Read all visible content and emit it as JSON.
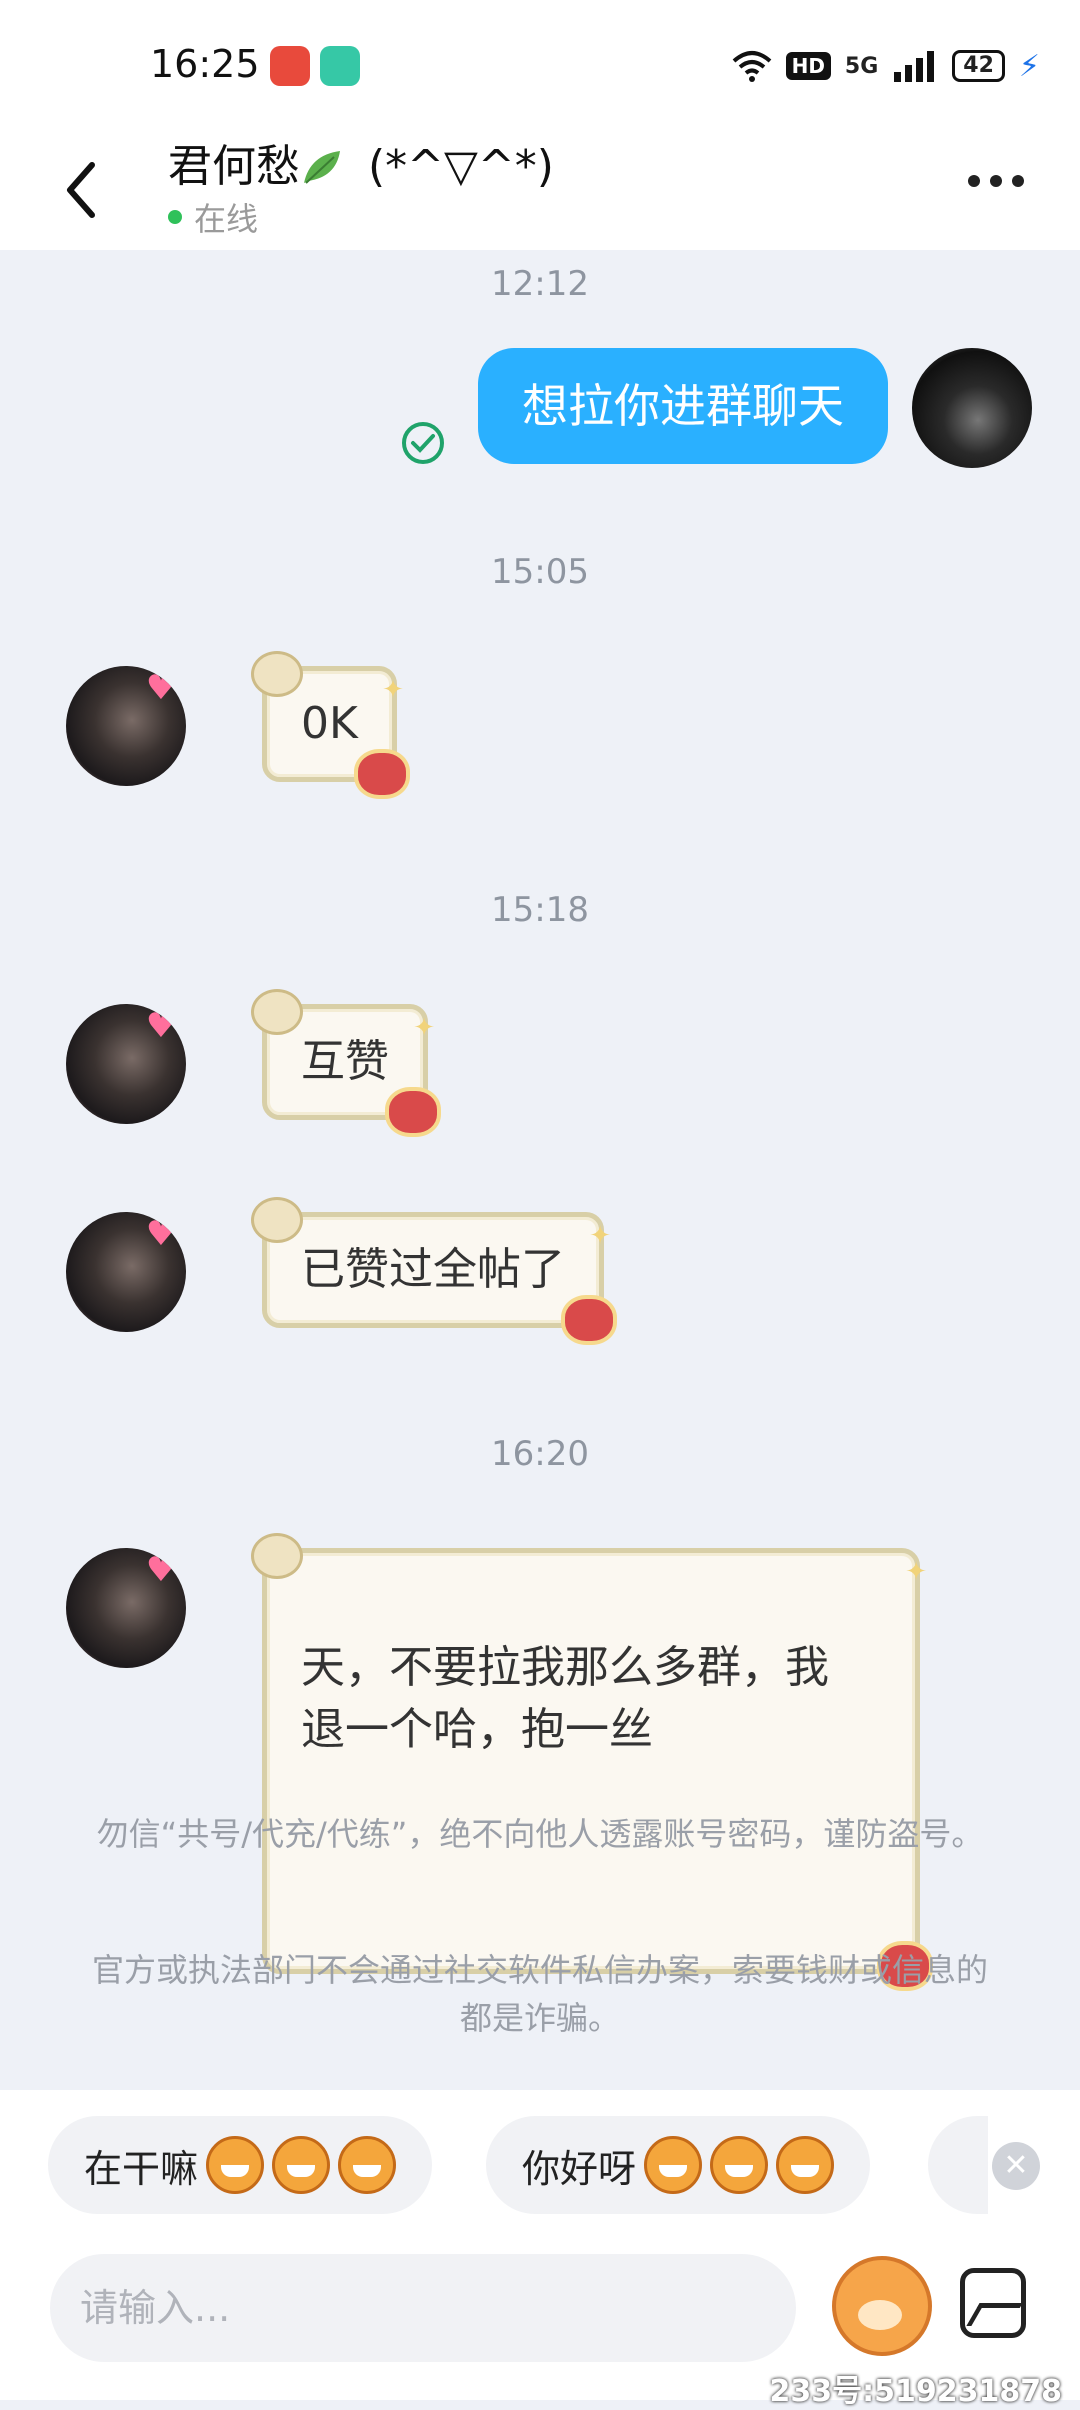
{
  "status": {
    "time": "16:25",
    "hd": "HD",
    "signal": "5G",
    "battery": "42"
  },
  "header": {
    "name": "君何愁",
    "name_suffix": " (*^▽^*)",
    "online": "在线"
  },
  "chat": {
    "timestamps": [
      "12:12",
      "15:05",
      "15:18",
      "16:20"
    ],
    "outgoing": [
      "想拉你进群聊天"
    ],
    "incoming": [
      "0K",
      "互赞",
      "已赞过全帖了",
      "天，不要拉我那么多群，我\n退一个哈，抱一丝"
    ]
  },
  "notices": [
    "勿信“共号/代充/代练”，绝不向他人透露账号密码，谨防盗号。",
    "官方或执法部门不会通过社交软件私信办案，索要钱财或信息的都是诈骗。"
  ],
  "quick_replies": [
    "在干嘛",
    "你好呀"
  ],
  "input": {
    "placeholder": "请输入..."
  },
  "watermark": "233号:519231878",
  "colors": {
    "accent": "#2ab0ff",
    "online": "#2fc15a",
    "bubble_border": "#d8cfa7"
  },
  "icons": [
    "back-arrow-icon",
    "more-dots-icon",
    "read-check-icon",
    "close-icon",
    "mascot-emoji-icon",
    "image-icon",
    "leaf-icon"
  ]
}
